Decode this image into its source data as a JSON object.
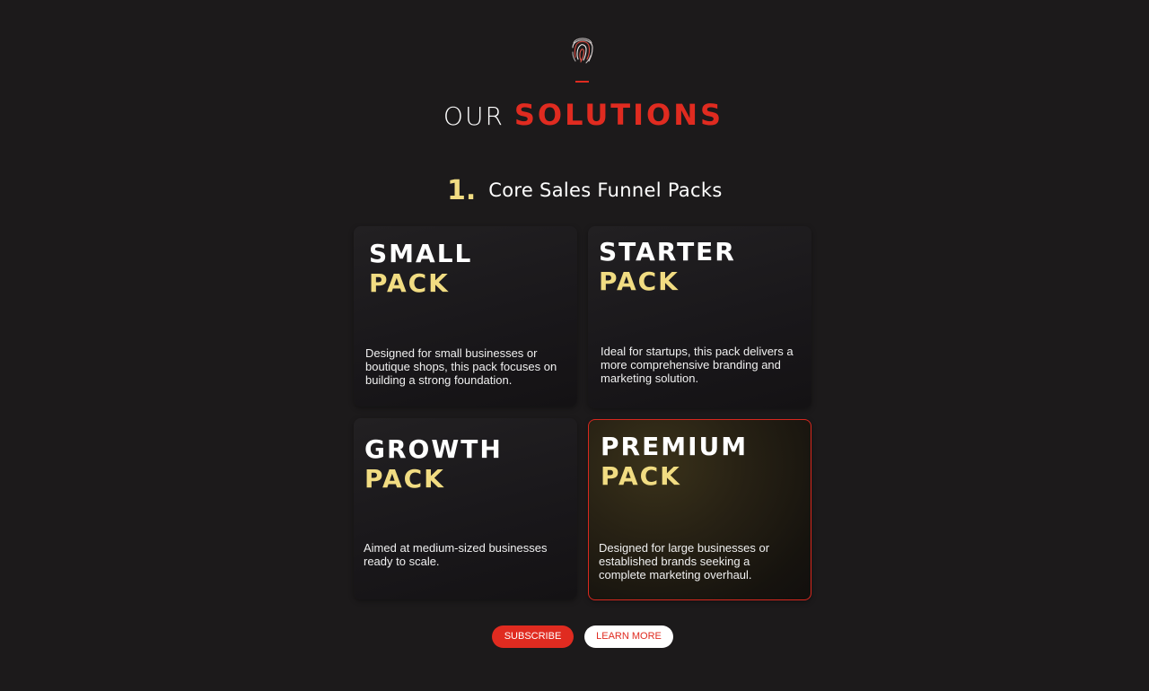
{
  "header": {
    "logo_icon": "fingerprint-icon",
    "title_light": "OUR",
    "title_bold": "SOLUTIONS"
  },
  "section": {
    "number": "1.",
    "title": "Core Sales Funnel Packs"
  },
  "cards": [
    {
      "title": "SMALL",
      "subtitle": "PACK",
      "description": "Designed for small businesses or boutique shops, this pack focuses on building a strong foundation.",
      "highlighted": false
    },
    {
      "title": "STARTER",
      "subtitle": "PACK",
      "description": "Ideal for startups, this pack delivers a more comprehensive branding and marketing solution.",
      "highlighted": false
    },
    {
      "title": "GROWTH",
      "subtitle": "PACK",
      "description": "Aimed at medium-sized businesses ready to scale.",
      "highlighted": false
    },
    {
      "title": "PREMIUM",
      "subtitle": "PACK",
      "description": "Designed for large businesses or established brands seeking a complete marketing overhaul.",
      "highlighted": true
    }
  ],
  "buttons": {
    "subscribe": "SUBSCRIBE",
    "learn_more": "LEARN MORE"
  },
  "colors": {
    "background": "#1c1a1b",
    "accent_red": "#e02b20",
    "accent_gold": "#f1dc82"
  }
}
